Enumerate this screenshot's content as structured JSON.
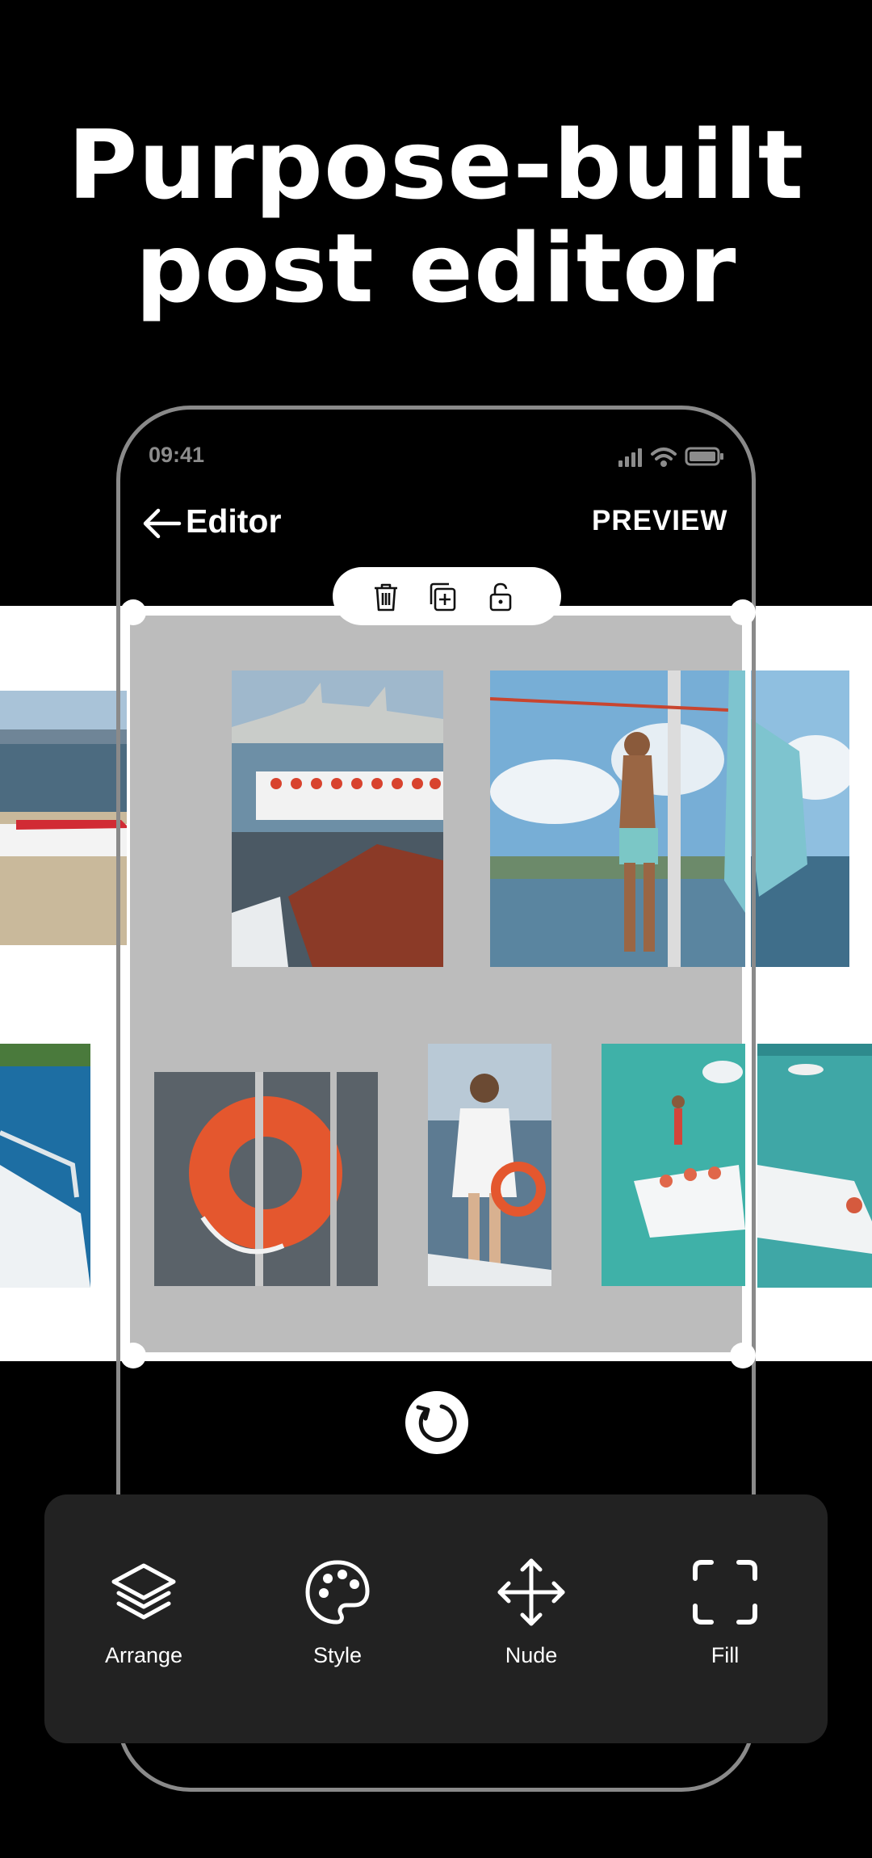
{
  "headline": {
    "line1": "Purpose-built",
    "line2": "post editor"
  },
  "status_bar": {
    "time": "09:41",
    "icons": [
      "signal-icon",
      "wifi-icon",
      "battery-icon"
    ]
  },
  "header": {
    "title": "Editor",
    "back_icon": "arrow-left-icon",
    "preview_label": "PREVIEW"
  },
  "selection_toolbar": {
    "icons": [
      "trash-icon",
      "duplicate-icon",
      "unlock-icon"
    ]
  },
  "photos": [
    "beach-boat",
    "port-ferry",
    "man-on-sailboat",
    "sea-yacht-left",
    "life-ring",
    "woman-on-boat",
    "party-boat",
    "jetski-sea"
  ],
  "rotate": {
    "icon": "rotate-icon"
  },
  "tools": [
    {
      "label": "Arrange",
      "icon": "layers-icon"
    },
    {
      "label": "Style",
      "icon": "palette-icon"
    },
    {
      "label": "Nude",
      "icon": "move-icon"
    },
    {
      "label": "Fill",
      "icon": "fill-frame-icon"
    }
  ],
  "colors": {
    "background": "#000000",
    "canvas": "#bcbcbc",
    "panel": "#222222",
    "text": "#ffffff"
  }
}
